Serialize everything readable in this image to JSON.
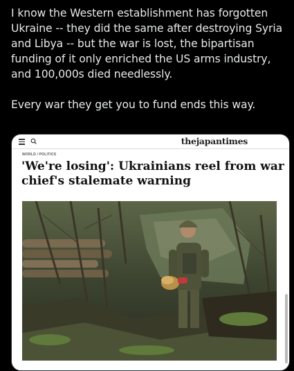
{
  "post": {
    "paragraph1": "I know the Western establishment has forgotten Ukraine -- they did the same after destroying Syria and Libya -- but the war is lost, the bipartisan funding of it only enriched the US arms industry, and 100,000s died needlessly.",
    "paragraph2": "Every war they get you to fund ends this way."
  },
  "card": {
    "logo": "thejapantimes",
    "kicker": "WORLD / POLITICS",
    "headline": "'We're losing': Ukrainians reel from war chief's stalemate warning",
    "icons": [
      "hamburger-menu-icon",
      "search-icon"
    ]
  },
  "colors": {
    "background": "#000000",
    "post_text": "#e7e9ea",
    "card_background": "#ffffff",
    "headline": "#111111"
  }
}
